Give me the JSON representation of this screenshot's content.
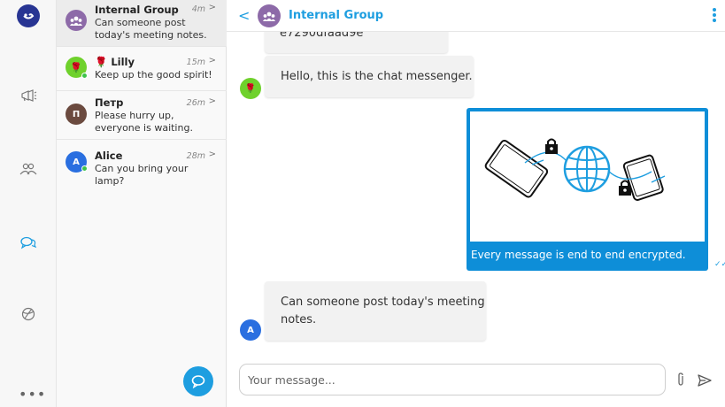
{
  "conversations": [
    {
      "name": "Internal Group",
      "time": "4m",
      "preview": "Can someone post today's meeting notes.",
      "avatar_color": "#8d6aa8",
      "active": true
    },
    {
      "name": "🌹 Lilly",
      "time": "15m",
      "preview": "Keep up the good spirit!",
      "avatar_color": "#6fd12c",
      "online": true
    },
    {
      "name": "Петр",
      "time": "26m",
      "preview": "Please hurry up, everyone is waiting.",
      "avatar_letter": "П",
      "avatar_color": "#6b4a3f"
    },
    {
      "name": "Alice",
      "time": "28m",
      "preview": "Can you bring your lamp?",
      "avatar_letter": "A",
      "avatar_color": "#2a6fe0",
      "online": true
    }
  ],
  "chat": {
    "title": "Internal Group",
    "messages": {
      "partial_top": "e7290dfaad9e",
      "hello": "Hello, this is the chat messenger.",
      "image_caption": "Every message is end to end encrypted.",
      "notes_line1": "Can someone post today's meeting",
      "notes_line2": "notes.",
      "alice_avatar_letter": "A"
    },
    "composer_placeholder": "Your message..."
  },
  "colors": {
    "accent": "#1e9ee0",
    "rail_logo": "#283593"
  }
}
